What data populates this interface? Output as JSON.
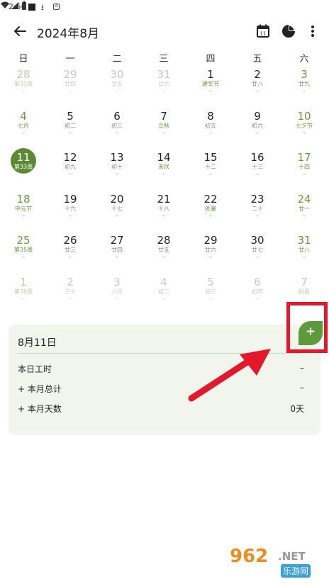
{
  "status_bar": {
    "time": "2:50",
    "icons": [
      "notification-square-icon",
      "download-icon",
      "font-a-icon",
      "wifi-icon",
      "signal-icon",
      "battery-icon"
    ]
  },
  "header": {
    "title": "2024年8月",
    "icons": [
      "back-arrow-icon",
      "calendar-icon",
      "pie-chart-icon",
      "more-vert-icon"
    ]
  },
  "weekdays": [
    "日",
    "一",
    "二",
    "三",
    "四",
    "五",
    "六"
  ],
  "weeks": [
    [
      {
        "day": "28",
        "lunar": "第31周",
        "dash": "–",
        "type": "other weekend"
      },
      {
        "day": "29",
        "lunar": "廿四",
        "dash": "–",
        "type": "other"
      },
      {
        "day": "30",
        "lunar": "廿五",
        "dash": "–",
        "type": "other"
      },
      {
        "day": "31",
        "lunar": "廿六",
        "dash": "–",
        "type": "other"
      },
      {
        "day": "1",
        "lunar": "建军节",
        "dash": "–",
        "type": "festival"
      },
      {
        "day": "2",
        "lunar": "廿八",
        "dash": "–",
        "type": ""
      },
      {
        "day": "3",
        "lunar": "廿九",
        "dash": "–",
        "type": "weekend"
      }
    ],
    [
      {
        "day": "4",
        "lunar": "七月",
        "dash": "–",
        "type": "weekend"
      },
      {
        "day": "5",
        "lunar": "初二",
        "dash": "–",
        "type": ""
      },
      {
        "day": "6",
        "lunar": "初三",
        "dash": "–",
        "type": ""
      },
      {
        "day": "7",
        "lunar": "立秋",
        "dash": "–",
        "type": "festival"
      },
      {
        "day": "8",
        "lunar": "初五",
        "dash": "–",
        "type": ""
      },
      {
        "day": "9",
        "lunar": "初六",
        "dash": "–",
        "type": ""
      },
      {
        "day": "10",
        "lunar": "七夕节",
        "dash": "–",
        "type": "weekend"
      }
    ],
    [
      {
        "day": "11",
        "lunar": "第33周",
        "dash": "",
        "type": "today"
      },
      {
        "day": "12",
        "lunar": "初九",
        "dash": "–",
        "type": ""
      },
      {
        "day": "13",
        "lunar": "初十",
        "dash": "–",
        "type": ""
      },
      {
        "day": "14",
        "lunar": "末伏",
        "dash": "–",
        "type": "festival"
      },
      {
        "day": "15",
        "lunar": "十二",
        "dash": "–",
        "type": ""
      },
      {
        "day": "16",
        "lunar": "十三",
        "dash": "–",
        "type": ""
      },
      {
        "day": "17",
        "lunar": "十四",
        "dash": "–",
        "type": "weekend"
      }
    ],
    [
      {
        "day": "18",
        "lunar": "中元节",
        "dash": "–",
        "type": "weekend"
      },
      {
        "day": "19",
        "lunar": "十六",
        "dash": "–",
        "type": ""
      },
      {
        "day": "20",
        "lunar": "十七",
        "dash": "–",
        "type": ""
      },
      {
        "day": "21",
        "lunar": "十八",
        "dash": "–",
        "type": ""
      },
      {
        "day": "22",
        "lunar": "处暑",
        "dash": "–",
        "type": "festival"
      },
      {
        "day": "23",
        "lunar": "二十",
        "dash": "–",
        "type": ""
      },
      {
        "day": "24",
        "lunar": "廿一",
        "dash": "–",
        "type": "weekend"
      }
    ],
    [
      {
        "day": "25",
        "lunar": "第35周",
        "dash": "–",
        "type": "weekend"
      },
      {
        "day": "26",
        "lunar": "廿三",
        "dash": "–",
        "type": ""
      },
      {
        "day": "27",
        "lunar": "廿四",
        "dash": "–",
        "type": ""
      },
      {
        "day": "28",
        "lunar": "廿五",
        "dash": "–",
        "type": ""
      },
      {
        "day": "29",
        "lunar": "廿六",
        "dash": "–",
        "type": ""
      },
      {
        "day": "30",
        "lunar": "廿七",
        "dash": "–",
        "type": ""
      },
      {
        "day": "31",
        "lunar": "廿八",
        "dash": "–",
        "type": "weekend"
      }
    ],
    [
      {
        "day": "1",
        "lunar": "第36周",
        "dash": "–",
        "type": "other weekend"
      },
      {
        "day": "2",
        "lunar": "三十",
        "dash": "–",
        "type": "other"
      },
      {
        "day": "3",
        "lunar": "八月",
        "dash": "–",
        "type": "other"
      },
      {
        "day": "4",
        "lunar": "初二",
        "dash": "–",
        "type": "other"
      },
      {
        "day": "5",
        "lunar": "初三",
        "dash": "–",
        "type": "other"
      },
      {
        "day": "6",
        "lunar": "初四",
        "dash": "–",
        "type": "other"
      },
      {
        "day": "7",
        "lunar": "白露",
        "dash": "–",
        "type": "other weekend"
      }
    ]
  ],
  "summary": {
    "date": "8月11日",
    "rows": [
      {
        "label": "本日工时",
        "value": "–"
      },
      {
        "label": "+ 本月总计",
        "value": "–"
      },
      {
        "label": "+ 本月天数",
        "value": "0天"
      }
    ]
  },
  "add_button": {
    "label": "+"
  },
  "watermark": {
    "brand": "962",
    "suffix": ".NET",
    "cn": "乐游网"
  },
  "colors": {
    "accent": "#5b8a35",
    "highlight": "#e3182d",
    "card_bg": "#f1f5ec"
  }
}
